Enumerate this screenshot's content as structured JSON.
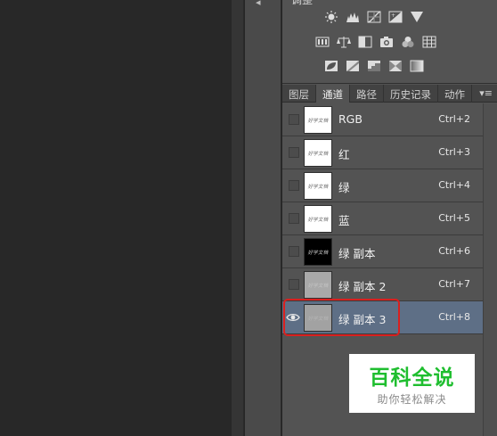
{
  "adjustments": {
    "title": "调整",
    "row1": [
      "brightness-contrast-icon",
      "levels-icon",
      "curves-icon",
      "exposure-icon",
      "triangle-icon"
    ],
    "row2": [
      "vibrance-icon",
      "color-balance-icon",
      "black-white-icon",
      "photo-filter-icon",
      "channel-mixer-icon",
      "color-lookup-icon"
    ],
    "row3": [
      "invert-icon",
      "posterize-icon",
      "threshold-icon",
      "gradient-map-icon",
      "selective-color-icon"
    ]
  },
  "tabs": [
    {
      "label": "图层",
      "active": false
    },
    {
      "label": "通道",
      "active": true
    },
    {
      "label": "路径",
      "active": false
    },
    {
      "label": "历史记录",
      "active": false
    },
    {
      "label": "动作",
      "active": false
    }
  ],
  "tab_menu": "▾≡",
  "channels": [
    {
      "name": "RGB",
      "shortcut": "Ctrl+2"
    },
    {
      "name": "红",
      "shortcut": "Ctrl+3"
    },
    {
      "name": "绿",
      "shortcut": "Ctrl+4"
    },
    {
      "name": "蓝",
      "shortcut": "Ctrl+5"
    },
    {
      "name": "绿 副本",
      "shortcut": "Ctrl+6"
    },
    {
      "name": "绿 副本 2",
      "shortcut": "Ctrl+7"
    },
    {
      "name": "绿 副本 3",
      "shortcut": "Ctrl+8",
      "selected": true,
      "visible": true
    }
  ],
  "thumb_text": "好学文档",
  "watermark": {
    "title": "百科全说",
    "subtitle": "助你轻松解决"
  },
  "colors": {
    "selected_row": "#5e6f86",
    "highlight_outline": "#d9201f",
    "watermark_green": "#1fbe2f"
  }
}
